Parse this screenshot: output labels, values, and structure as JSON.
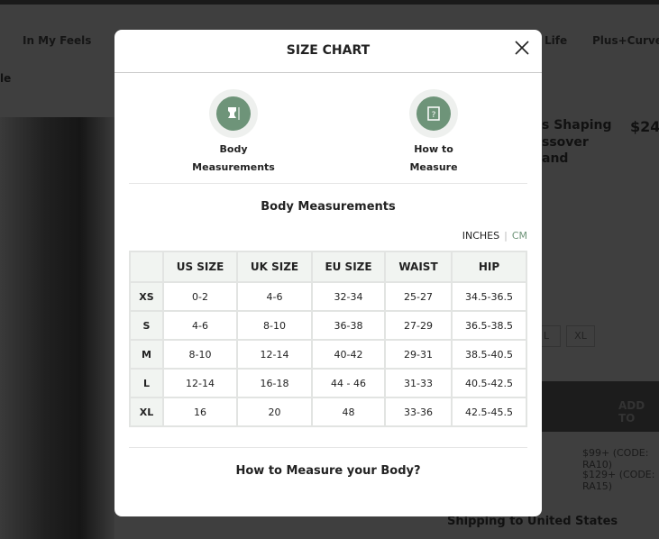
{
  "background": {
    "nav": [
      "In My Feels",
      "Life",
      "Plus+Curve"
    ],
    "partial_nav": "le",
    "product_title": [
      "s Shaping",
      "ssover",
      "and"
    ],
    "price": "$24",
    "sizes": [
      "L",
      "XL"
    ],
    "add_button": "ADD TO",
    "promos": [
      "$99+ (CODE: RA10)",
      "$129+ (CODE: RA15)"
    ],
    "shipping": "Shipping to United States"
  },
  "modal": {
    "title": "SIZE CHART",
    "options": [
      {
        "label1": "Body",
        "label2": "Measurements",
        "icon": "body-measurements-icon"
      },
      {
        "label1": "How to",
        "label2": "Measure",
        "icon": "how-to-measure-icon"
      }
    ],
    "section_title": "Body Measurements",
    "units": {
      "inches": "INCHES",
      "separator": "|",
      "cm": "CM",
      "active": "INCHES"
    },
    "accent": "#6e9479",
    "table": {
      "headers": [
        "",
        "US SIZE",
        "UK SIZE",
        "EU SIZE",
        "WAIST",
        "HIP"
      ],
      "rows": [
        [
          "XS",
          "0-2",
          "4-6",
          "32-34",
          "25-27",
          "34.5-36.5"
        ],
        [
          "S",
          "4-6",
          "8-10",
          "36-38",
          "27-29",
          "36.5-38.5"
        ],
        [
          "M",
          "8-10",
          "12-14",
          "40-42",
          "29-31",
          "38.5-40.5"
        ],
        [
          "L",
          "12-14",
          "16-18",
          "44 - 46",
          "31-33",
          "40.5-42.5"
        ],
        [
          "XL",
          "16",
          "20",
          "48",
          "33-36",
          "42.5-45.5"
        ]
      ]
    },
    "how_to_link": "How to Measure your Body?"
  }
}
